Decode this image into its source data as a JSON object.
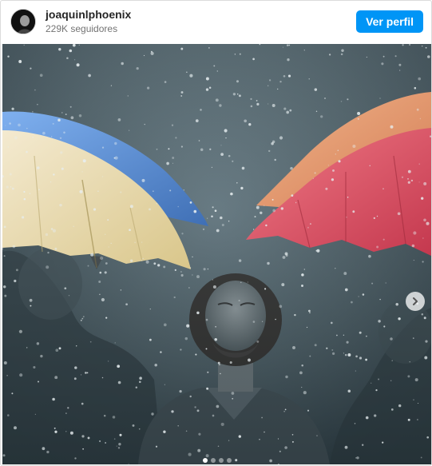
{
  "header": {
    "username": "joaquinlphoenix",
    "followers": "229K seguidores",
    "view_profile_label": "Ver perfil"
  },
  "media": {
    "icons": {
      "next": "chevron-right-icon",
      "avatar": "profile-photo"
    },
    "carousel": {
      "total": 4,
      "active_index": 0
    },
    "colors": {
      "umbrella_blue": "#5a8fd6",
      "umbrella_cream": "#e9dcb0",
      "umbrella_orange": "#e89a6c",
      "umbrella_pink": "#e0566a",
      "button_blue": "#0095f6"
    }
  }
}
